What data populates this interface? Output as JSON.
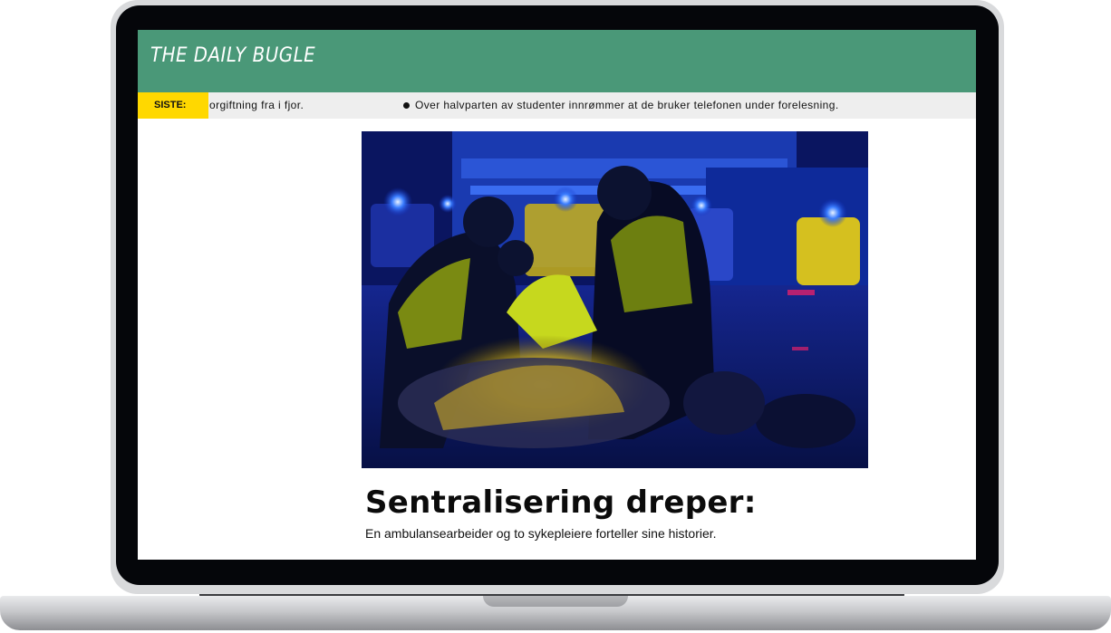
{
  "site": {
    "name": "THE DAILY BUGLE",
    "brand_color": "#4a9878"
  },
  "ticker": {
    "label": "SISTE:",
    "label_color": "#ffd800",
    "items": [
      "orgiftning fra i fjor.",
      "Over halvparten av studenter innrømmer at de bruker telefonen under forelesning."
    ]
  },
  "article": {
    "headline": "Sentralisering dreper:",
    "subheadline": "En ambulansearbeider og to sykepleiere forteller sine historier.",
    "image": {
      "icon": "photo-icon",
      "subject": "paramedics-at-night"
    }
  }
}
